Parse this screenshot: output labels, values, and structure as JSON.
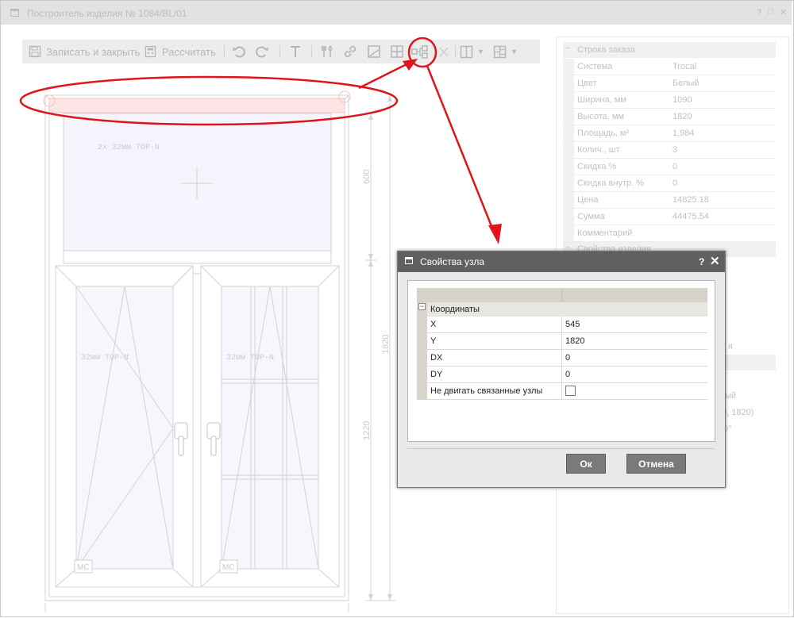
{
  "window": {
    "title": "Построитель изделия № 1084/BL/01",
    "controls": [
      "?",
      "□",
      "✕"
    ]
  },
  "toolbar": {
    "save_close_label": "Записать и закрыть",
    "calculate_label": "Рассчитать"
  },
  "drawing": {
    "glass_top": "2х 32мм TOP-N",
    "glass_left": "32мм TOP-N",
    "glass_right": "32мм TOP-N",
    "dim_top": "600",
    "dim_total": "1820",
    "dim_bottom": "1220",
    "mc_left": "MC",
    "mc_right": "MC"
  },
  "properties": {
    "group_order": "Строка заказа",
    "rows": [
      {
        "label": "Система",
        "value": "Trocal"
      },
      {
        "label": "Цвет",
        "value": "Белый"
      },
      {
        "label": "Ширина, мм",
        "value": "1090"
      },
      {
        "label": "Высота, мм",
        "value": "1820"
      },
      {
        "label": "Площадь, м²",
        "value": "1,984"
      },
      {
        "label": "Колич., шт",
        "value": "3"
      },
      {
        "label": "Скидка %",
        "value": "0"
      },
      {
        "label": "Скидка внутр. %",
        "value": "0"
      },
      {
        "label": "Цена",
        "value": "14825.18"
      },
      {
        "label": "Сумма",
        "value": "44475.54"
      },
      {
        "label": "Комментарий",
        "value": ""
      }
    ],
    "group_item": "Свойства изделия",
    "partial_1": "я",
    "partial_2": "ый",
    "partial_3": "0, 1820)",
    "partial_4": "0°"
  },
  "dialog": {
    "title": "Свойства узла",
    "help": "?",
    "close": "✕",
    "group": "Координаты",
    "fields": [
      {
        "label": "X",
        "value": "545"
      },
      {
        "label": "Y",
        "value": "1820"
      },
      {
        "label": "DX",
        "value": "0"
      },
      {
        "label": "DY",
        "value": "0"
      }
    ],
    "checkbox_label": "Не двигать связанные узлы",
    "ok_label": "Ок",
    "cancel_label": "Отмена"
  },
  "colors": {
    "annotation": "#e0141c",
    "dialog_title": "#606060",
    "button": "#7a7a7a"
  }
}
